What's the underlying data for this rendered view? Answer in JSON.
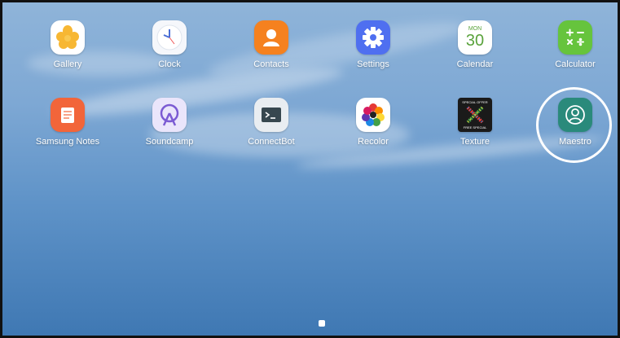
{
  "home_screen": {
    "apps": [
      {
        "id": "gallery",
        "label": "Gallery",
        "icon": "flower-icon",
        "color": "#f7b733"
      },
      {
        "id": "clock",
        "label": "Clock",
        "icon": "clock-icon",
        "color": "#f5f7fb"
      },
      {
        "id": "contacts",
        "label": "Contacts",
        "icon": "person-icon",
        "color": "#f5811f"
      },
      {
        "id": "settings",
        "label": "Settings",
        "icon": "gear-icon",
        "color": "#4f6ff0"
      },
      {
        "id": "calendar",
        "label": "Calendar",
        "icon": "calendar-icon",
        "color": "#ffffff",
        "month": "MON",
        "day": "30"
      },
      {
        "id": "calculator",
        "label": "Calculator",
        "icon": "calculator-icon",
        "color": "#66c43d"
      },
      {
        "id": "samsung_notes",
        "label": "Samsung Notes",
        "icon": "notepad-icon",
        "color": "#f2653a"
      },
      {
        "id": "soundcamp",
        "label": "Soundcamp",
        "icon": "radio-tower-icon",
        "color": "#eae5fb"
      },
      {
        "id": "connectbot",
        "label": "ConnectBot",
        "icon": "terminal-icon",
        "color": "#e9edf1"
      },
      {
        "id": "recolor",
        "label": "Recolor",
        "icon": "color-wheel-icon",
        "color": "#ffffff"
      },
      {
        "id": "texture",
        "label": "Texture",
        "icon": "texture-x-icon",
        "color": "#1a1a1a",
        "badge_top": "SPECIAL OFFER",
        "badge_bottom": "FREE SPECIAL"
      },
      {
        "id": "maestro",
        "label": "Maestro",
        "icon": "person-circle-icon",
        "color": "#2a8a7b"
      }
    ],
    "highlighted_app": "Maestro",
    "page_indicator": {
      "pages": 1,
      "current": 1
    }
  }
}
